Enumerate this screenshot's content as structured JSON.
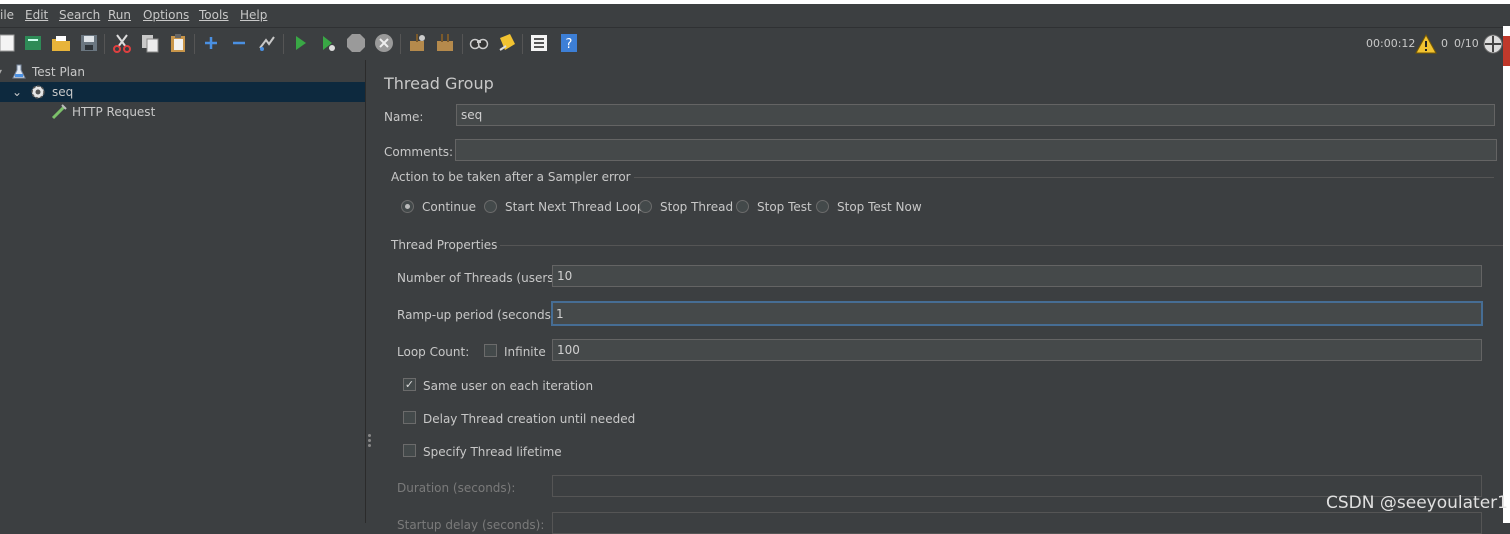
{
  "menu": {
    "file": "ile",
    "edit": "Edit",
    "search": "Search",
    "run": "Run",
    "options": "Options",
    "tools": "Tools",
    "help": "Help"
  },
  "toolbar": {
    "icons": [
      "new-icon",
      "templates-icon",
      "open-icon",
      "save-icon",
      "cut-icon",
      "copy-icon",
      "paste-icon",
      "expand-icon",
      "collapse-icon",
      "toggle-icon",
      "start-icon",
      "start-no-pauses-icon",
      "stop-icon",
      "shutdown-icon",
      "clear-icon",
      "clear-all-icon",
      "search-icon",
      "reset-search-icon",
      "function-helper-icon",
      "help-icon"
    ],
    "timer": "00:00:12",
    "warning_count": "0",
    "threads": "0/10"
  },
  "tree": {
    "items": [
      {
        "label": "Test Plan",
        "icon": "test-plan-icon"
      },
      {
        "label": "seq",
        "icon": "thread-group-gear-icon"
      },
      {
        "label": "HTTP Request",
        "icon": "http-request-pipette-icon"
      }
    ]
  },
  "form": {
    "title": "Thread Group",
    "name_label": "Name:",
    "name_value": "seq",
    "comments_label": "Comments:",
    "comments_value": "",
    "sampler_error_section": "Action to be taken after a Sampler error",
    "sampler_error_options": [
      "Continue",
      "Start Next Thread Loop",
      "Stop Thread",
      "Stop Test",
      "Stop Test Now"
    ],
    "sampler_error_selected": "Continue",
    "thread_props_section": "Thread Properties",
    "threads_label": "Number of Threads (users):",
    "threads_value": "10",
    "rampup_label": "Ramp-up period (seconds):",
    "rampup_value": "1",
    "loop_label": "Loop Count:",
    "infinite_label": "Infinite",
    "infinite_checked": false,
    "loop_value": "100",
    "same_user_label": "Same user on each iteration",
    "same_user_checked": true,
    "delay_label": "Delay Thread creation until needed",
    "delay_checked": false,
    "lifetime_label": "Specify Thread lifetime",
    "lifetime_checked": false,
    "duration_label": "Duration (seconds):",
    "duration_value": "",
    "startup_delay_label": "Startup delay (seconds):",
    "startup_delay_value": ""
  },
  "watermark": "CSDN @seeyoulater1",
  "colors": {
    "background": "#3c3f41",
    "selected_row": "#0d293e",
    "focus_border": "#466d94",
    "text": "#bbbbbb"
  }
}
